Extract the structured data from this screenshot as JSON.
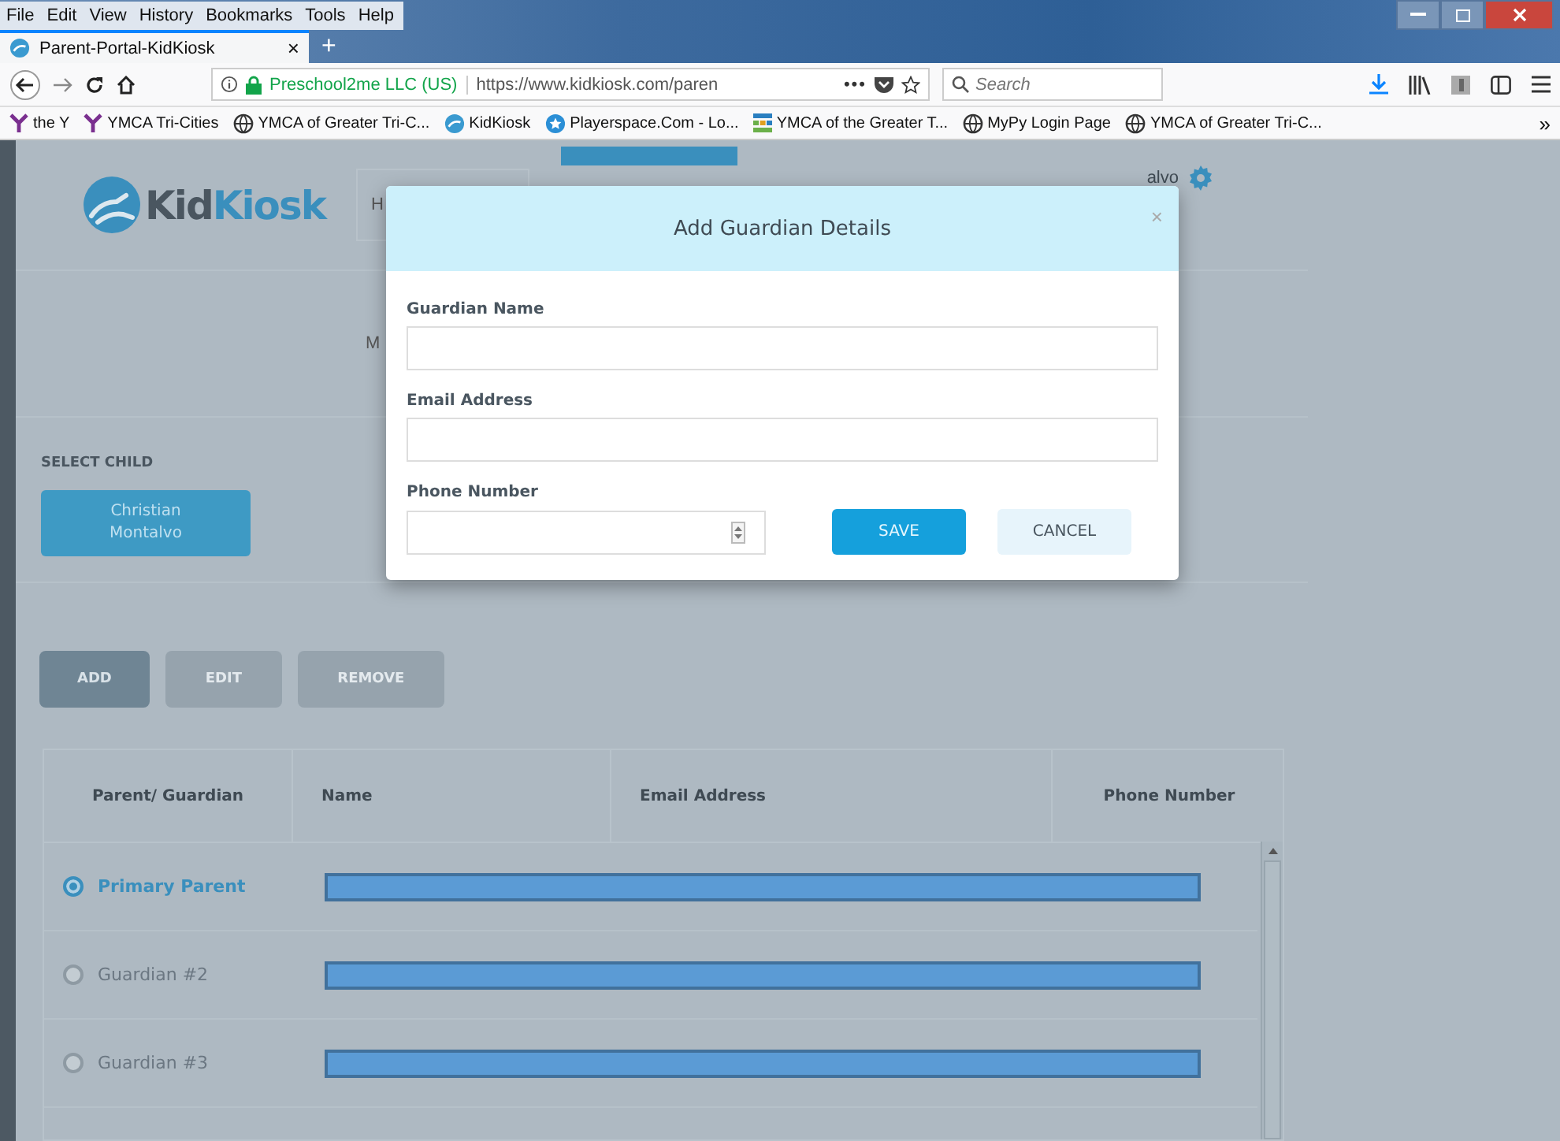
{
  "browser": {
    "menu": [
      "File",
      "Edit",
      "View",
      "History",
      "Bookmarks",
      "Tools",
      "Help"
    ],
    "tab": {
      "title": "Parent-Portal-KidKiosk",
      "close": "×",
      "new": "+"
    },
    "url": {
      "identity": "Preschool2me LLC (US)",
      "text": "https://www.kidkiosk.com/paren",
      "more": "•••"
    },
    "search": {
      "placeholder": "Search"
    },
    "bookmarks": [
      {
        "label": "the Y",
        "kind": "ymca"
      },
      {
        "label": "YMCA Tri-Cities",
        "kind": "ymca"
      },
      {
        "label": "YMCA of Greater Tri-C...",
        "kind": "globe"
      },
      {
        "label": "KidKiosk",
        "kind": "kidkiosk"
      },
      {
        "label": "Playerspace.Com - Lo...",
        "kind": "star"
      },
      {
        "label": "YMCA of the Greater T...",
        "kind": "grid"
      },
      {
        "label": "MyPy Login Page",
        "kind": "globe"
      },
      {
        "label": "YMCA of Greater Tri-C...",
        "kind": "globe"
      }
    ],
    "bookmarks_overflow": "»"
  },
  "page": {
    "logo": [
      "Kid",
      "Kiosk"
    ],
    "nav_partial": "H",
    "user_partial": "alvo",
    "section_partial": "M",
    "select_child": {
      "label": "SELECT CHILD",
      "children": [
        {
          "name": "Christian Montalvo",
          "selected": true
        }
      ]
    },
    "actions": [
      {
        "label": "ADD",
        "disabled": false
      },
      {
        "label": "EDIT",
        "disabled": true
      },
      {
        "label": "REMOVE",
        "disabled": true
      }
    ],
    "table": {
      "columns": [
        "Parent/ Guardian",
        "Name",
        "Email Address",
        "Phone Number"
      ],
      "rows": [
        {
          "role": "Primary Parent",
          "selected": true,
          "redacted": true
        },
        {
          "role": "Guardian #2",
          "selected": false,
          "redacted": true
        },
        {
          "role": "Guardian #3",
          "selected": false,
          "redacted": true
        }
      ]
    }
  },
  "modal": {
    "title": "Add Guardian Details",
    "close": "×",
    "fields": [
      {
        "label": "Guardian Name",
        "kind": "text"
      },
      {
        "label": "Email Address",
        "kind": "text"
      },
      {
        "label": "Phone Number",
        "kind": "number"
      }
    ],
    "buttons": [
      {
        "label": "SAVE",
        "kind": "primary"
      },
      {
        "label": "CANCEL",
        "kind": "secondary"
      }
    ]
  }
}
